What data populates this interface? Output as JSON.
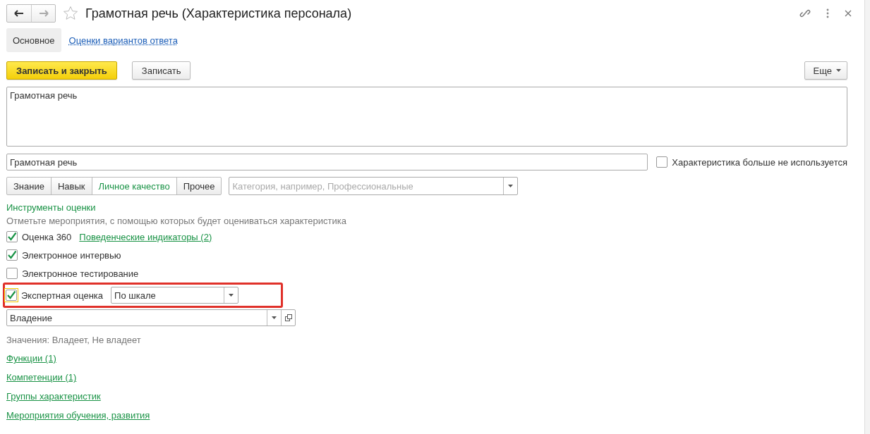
{
  "window": {
    "title": "Грамотная речь (Характеристика персонала)",
    "favorite": false
  },
  "tabs": [
    {
      "label": "Основное",
      "selected": true
    },
    {
      "label": "Оценки вариантов ответа",
      "selected": false
    }
  ],
  "command_bar": {
    "buttons": [
      {
        "label": "Записать и закрыть",
        "kind": "primary"
      },
      {
        "label": "Записать",
        "kind": "normal"
      }
    ],
    "more": {
      "label": "Еще"
    }
  },
  "description": {
    "value": "Грамотная речь"
  },
  "name": {
    "value": "Грамотная речь"
  },
  "not_used": {
    "label": "Характеристика больше не используется",
    "checked": false
  },
  "type_switch": [
    {
      "label": "Знание",
      "selected": false
    },
    {
      "label": "Навык",
      "selected": false
    },
    {
      "label": "Личное качество",
      "selected": true
    },
    {
      "label": "Прочее",
      "selected": false
    }
  ],
  "category": {
    "placeholder": "Категория, например, Профессиональные"
  },
  "tools": {
    "title": "Инструменты оценки",
    "hint": "Отметьте мероприятия, с помощью которых будет оцениваться характеристика",
    "items": [
      {
        "kind": "link",
        "label": "Оценка 360",
        "checked": true,
        "focused": false,
        "highlighted": false,
        "link": "Поведенческие индикаторы (2)"
      },
      {
        "kind": "plain",
        "label": "Электронное интервью",
        "checked": true,
        "focused": false,
        "highlighted": false
      },
      {
        "kind": "plain",
        "label": "Электронное тестирование",
        "checked": false,
        "focused": false,
        "highlighted": false
      },
      {
        "kind": "select",
        "label": "Экспертная оценка",
        "checked": true,
        "focused": true,
        "highlighted": true,
        "value": "По шкале"
      }
    ]
  },
  "scale": {
    "value": "Владение"
  },
  "values_note": "Значения: Владеет, Не владеет",
  "links": [
    "Функции (1)",
    "Компетенции (1)",
    "Группы характеристик",
    "Мероприятия обучения, развития"
  ]
}
